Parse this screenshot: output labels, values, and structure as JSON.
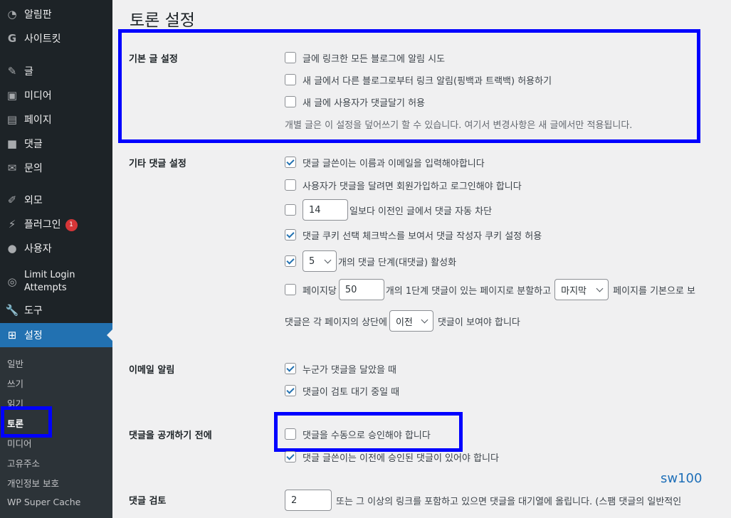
{
  "sidebar": {
    "items": [
      {
        "label": "알림판",
        "icon": "dashboard-icon"
      },
      {
        "label": "사이트킷",
        "icon": "google-g-icon"
      },
      {
        "label": "글",
        "icon": "pin-icon"
      },
      {
        "label": "미디어",
        "icon": "media-icon"
      },
      {
        "label": "페이지",
        "icon": "page-icon"
      },
      {
        "label": "댓글",
        "icon": "comment-icon"
      },
      {
        "label": "문의",
        "icon": "mail-icon"
      },
      {
        "label": "외모",
        "icon": "brush-icon"
      },
      {
        "label": "플러그인",
        "icon": "plugin-icon",
        "badge": "1"
      },
      {
        "label": "사용자",
        "icon": "user-icon"
      },
      {
        "label": "Limit Login Attempts",
        "icon": "fingerprint-icon"
      },
      {
        "label": "도구",
        "icon": "wrench-icon"
      },
      {
        "label": "설정",
        "icon": "settings-icon"
      }
    ],
    "submenu": [
      "일반",
      "쓰기",
      "읽기",
      "토론",
      "미디어",
      "고유주소",
      "개인정보 보호",
      "WP Super Cache"
    ]
  },
  "main": {
    "title": "토론 설정",
    "default_post": {
      "label": "기본 글 설정",
      "options": [
        "글에 링크한 모든 블로그에 알림 시도",
        "새 글에서 다른 블로그로부터 링크 알림(핑백과 트랙백) 허용하기",
        "새 글에 사용자가 댓글달기 허용"
      ],
      "description": "개별 글은 이 설정을 덮어쓰기 할 수 있습니다. 여기서 변경사항은 새 글에서만 적용됩니다."
    },
    "other_comment": {
      "label": "기타 댓글 설정",
      "require_name_email": "댓글 글쓴이는 이름과 이메일을 입력해야합니다",
      "require_login": "사용자가 댓글을 달려면 회원가입하고 로그인해야 합니다",
      "close_days_value": "14",
      "close_days_suffix": "일보다 이전인 글에서 댓글 자동 차단",
      "cookies": "댓글 쿠키 선택 체크박스를 보여서 댓글 작성자 쿠키 설정 허용",
      "thread_depth_value": "5",
      "thread_depth_suffix": "개의 댓글 단계(대댓글) 활성화",
      "paginate_prefix": "페이지당",
      "per_page_value": "50",
      "per_page_mid": "개의 1단계 댓글이 있는 페이지로 분할하고",
      "default_page_value": "마지막",
      "default_page_suffix": "페이지를 기본으로 보",
      "order_prefix": "댓글은 각 페이지의 상단에",
      "order_value": "이전",
      "order_suffix": "댓글이 보여야 합니다"
    },
    "email_notify": {
      "label": "이메일 알림",
      "options": [
        "누군가 댓글을 달았을 때",
        "댓글이 검토 대기 중일 때"
      ]
    },
    "before_appear": {
      "label": "댓글을 공개하기 전에",
      "options": [
        "댓글을 수동으로 승인해야 합니다",
        "댓글 글쓴이는 이전에 승인된 댓글이 있어야 합니다"
      ]
    },
    "moderation": {
      "label": "댓글 검토",
      "links_value": "2",
      "links_suffix": "또는 그 이상의 링크를 포함하고 있으면 댓글을 대기열에 올립니다. (스팸 댓글의 일반적인"
    },
    "watermark": "sw100"
  },
  "colors": {
    "sidebar_bg": "#1d2327",
    "accent": "#2271b1",
    "highlight_box": "#0000ff",
    "badge": "#d63638"
  }
}
